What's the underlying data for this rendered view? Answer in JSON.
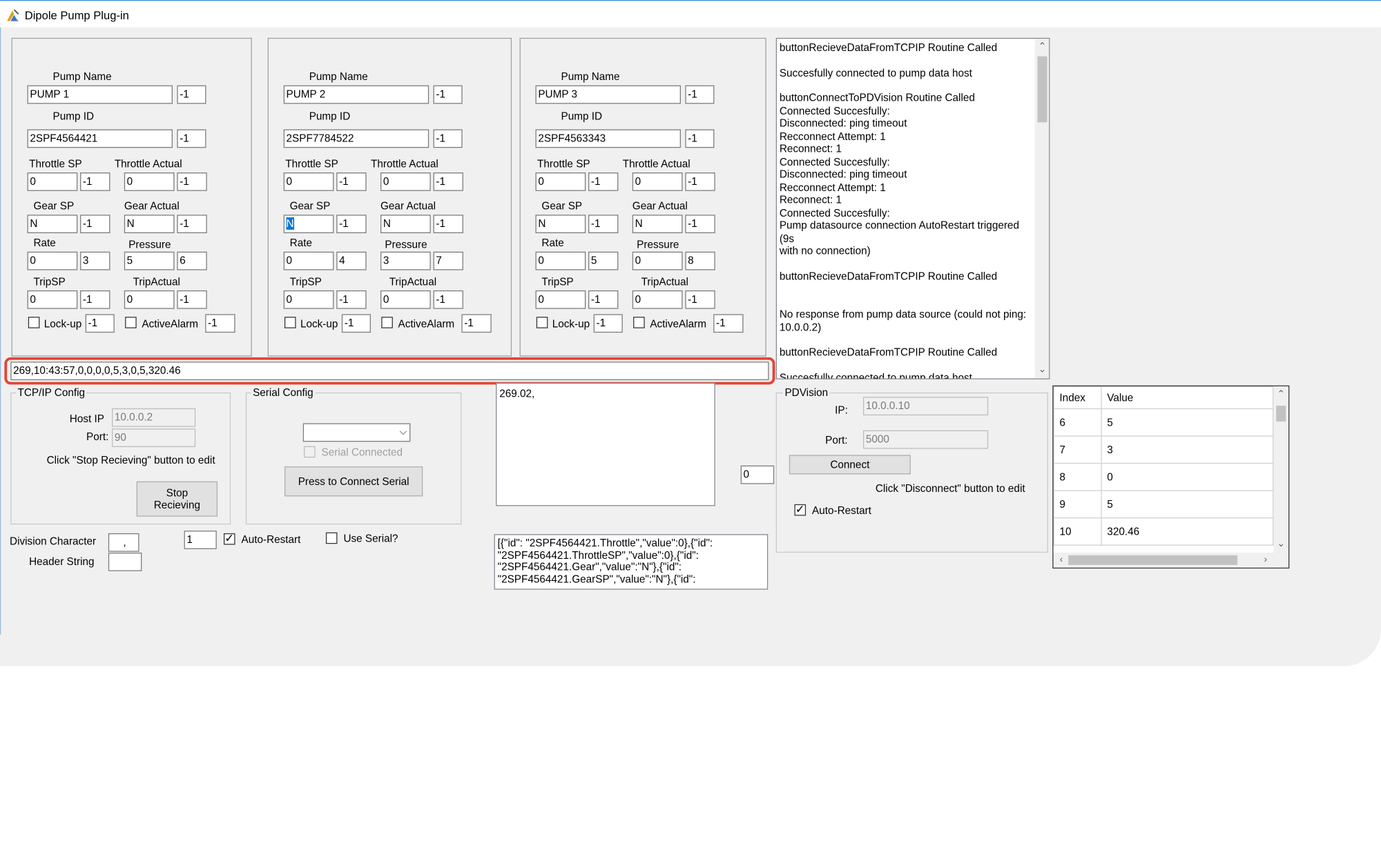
{
  "window": {
    "title": "Dipole Pump Plug-in"
  },
  "pumps": [
    {
      "name_label": "Pump Name",
      "name": "PUMP 1",
      "name_idx": "-1",
      "id_label": "Pump ID",
      "id": "2SPF4564421",
      "id_idx": "-1",
      "throttle_sp_label": "Throttle SP",
      "throttle_sp": "0",
      "throttle_sp_idx": "-1",
      "throttle_actual_label": "Throttle Actual",
      "throttle_actual": "0",
      "throttle_actual_idx": "-1",
      "gear_sp_label": "Gear SP",
      "gear_sp": "N",
      "gear_sp_idx": "-1",
      "gear_actual_label": "Gear Actual",
      "gear_actual": "N",
      "gear_actual_idx": "-1",
      "rate_label": "Rate",
      "rate": "0",
      "rate_idx": "3",
      "pressure_label": "Pressure",
      "pressure": "5",
      "pressure_idx": "6",
      "trip_sp_label": "TripSP",
      "trip_sp": "0",
      "trip_sp_idx": "-1",
      "trip_actual_label": "TripActual",
      "trip_actual": "0",
      "trip_actual_idx": "-1",
      "lockup_label": "Lock-up",
      "lockup_idx": "-1",
      "alarm_label": "ActiveAlarm",
      "alarm_idx": "-1"
    },
    {
      "name_label": "Pump Name",
      "name": "PUMP 2",
      "name_idx": "-1",
      "id_label": "Pump ID",
      "id": "2SPF7784522",
      "id_idx": "-1",
      "throttle_sp_label": "Throttle SP",
      "throttle_sp": "0",
      "throttle_sp_idx": "-1",
      "throttle_actual_label": "Throttle Actual",
      "throttle_actual": "0",
      "throttle_actual_idx": "-1",
      "gear_sp_label": "Gear SP",
      "gear_sp": "N",
      "gear_sp_idx": "-1",
      "gear_actual_label": "Gear Actual",
      "gear_actual": "N",
      "gear_actual_idx": "-1",
      "rate_label": "Rate",
      "rate": "0",
      "rate_idx": "4",
      "pressure_label": "Pressure",
      "pressure": "3",
      "pressure_idx": "7",
      "trip_sp_label": "TripSP",
      "trip_sp": "0",
      "trip_sp_idx": "-1",
      "trip_actual_label": "TripActual",
      "trip_actual": "0",
      "trip_actual_idx": "-1",
      "lockup_label": "Lock-up",
      "lockup_idx": "-1",
      "alarm_label": "ActiveAlarm",
      "alarm_idx": "-1"
    },
    {
      "name_label": "Pump Name",
      "name": "PUMP 3",
      "name_idx": "-1",
      "id_label": "Pump ID",
      "id": "2SPF4563343",
      "id_idx": "-1",
      "throttle_sp_label": "Throttle SP",
      "throttle_sp": "0",
      "throttle_sp_idx": "-1",
      "throttle_actual_label": "Throttle Actual",
      "throttle_actual": "0",
      "throttle_actual_idx": "-1",
      "gear_sp_label": "Gear SP",
      "gear_sp": "N",
      "gear_sp_idx": "-1",
      "gear_actual_label": "Gear Actual",
      "gear_actual": "N",
      "gear_actual_idx": "-1",
      "rate_label": "Rate",
      "rate": "0",
      "rate_idx": "5",
      "pressure_label": "Pressure",
      "pressure": "0",
      "pressure_idx": "8",
      "trip_sp_label": "TripSP",
      "trip_sp": "0",
      "trip_sp_idx": "-1",
      "trip_actual_label": "TripActual",
      "trip_actual": "0",
      "trip_actual_idx": "-1",
      "lockup_label": "Lock-up",
      "lockup_idx": "-1",
      "alarm_label": "ActiveAlarm",
      "alarm_idx": "-1"
    }
  ],
  "log": [
    "buttonRecieveDataFromTCPIP Routine Called",
    "Succesfully connected to pump data host",
    "buttonConnectToPDVision Routine Called",
    "Connected Succesfully:",
    "Disconnected: ping timeout",
    "Recconnect Attempt: 1",
    "Reconnect: 1",
    "Connected Succesfully:",
    "Disconnected: ping timeout",
    "Recconnect Attempt: 1",
    "Reconnect: 1",
    "Connected Succesfully:",
    "Pump datasource connection AutoRestart triggered (9s\nwith no connection)",
    "buttonRecieveDataFromTCPIP Routine Called",
    "No response from pump data source (could not ping:\n10.0.0.2)",
    "buttonRecieveDataFromTCPIP Routine Called",
    "Succesfully connected to pump data host"
  ],
  "raw_data": "269,10:43:57,0,0,0,0,5,3,0,5,320.46",
  "tcpip": {
    "title": "TCP/IP Config",
    "host_label": "Host IP",
    "host": "10.0.0.2",
    "port_label": "Port:",
    "port": "90",
    "hint": "Click \"Stop Recieving\" button to edit",
    "stop_button": "Stop\nRecieving"
  },
  "serial": {
    "title": "Serial Config",
    "port_value": "",
    "connected_label": "Serial Connected",
    "connect_button": "Press to Connect Serial"
  },
  "received_text": "269.02,",
  "json_preview": "[{\"id\": \"2SPF4564421.Throttle\",\"value\":0},{\"id\":\n\"2SPF4564421.ThrottleSP\",\"value\":0},{\"id\":\n\"2SPF4564421.Gear\",\"value\":\"N\"},{\"id\":\n\"2SPF4564421.GearSP\",\"value\":\"N\"},{\"id\":",
  "counter_value": "0",
  "pdvision": {
    "title": "PDVision",
    "ip_label": "IP:",
    "ip": "10.0.0.10",
    "port_label": "Port:",
    "port": "5000",
    "connect_button": "Connect",
    "hint": "Click \"Disconnect\" button to edit",
    "autorestart_label": "Auto-Restart"
  },
  "bottom": {
    "division_label": "Division Character",
    "division": ",",
    "header_label": "Header String",
    "header": "",
    "restart_seconds": "1",
    "autorestart_label": "Auto-Restart",
    "use_serial_label": "Use Serial?"
  },
  "index_table": {
    "headers": [
      "Index",
      "Value"
    ],
    "rows": [
      [
        "6",
        "5"
      ],
      [
        "7",
        "3"
      ],
      [
        "8",
        "0"
      ],
      [
        "9",
        "5"
      ],
      [
        "10",
        "320.46"
      ]
    ]
  }
}
